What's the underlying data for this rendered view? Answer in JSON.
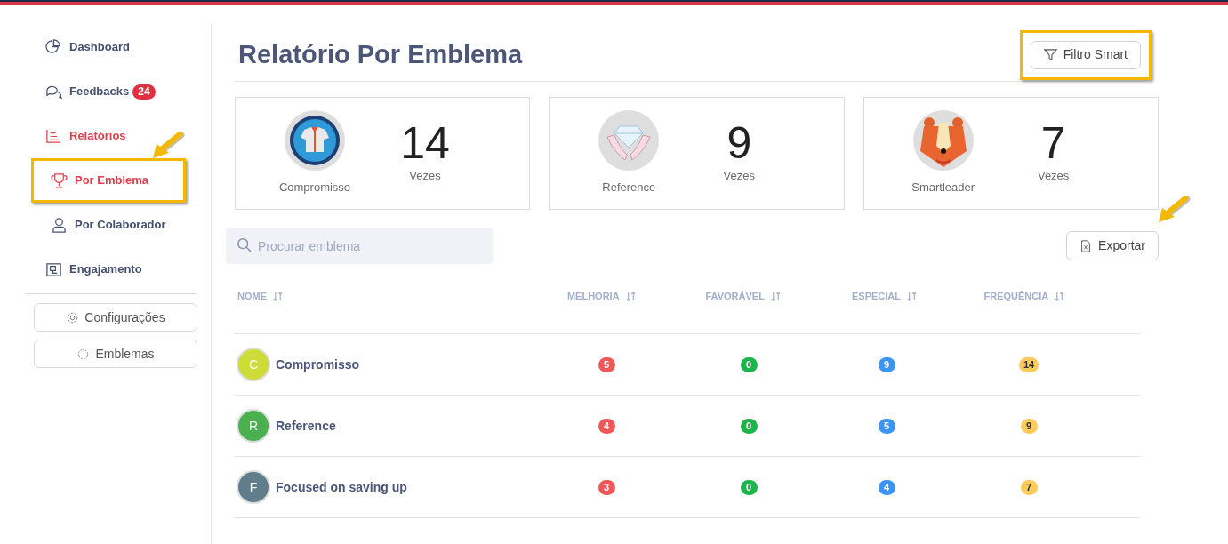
{
  "sidebar": {
    "items": [
      {
        "label": "Dashboard",
        "selected": false
      },
      {
        "label": "Feedbacks",
        "selected": false,
        "badge": "24"
      },
      {
        "label": "Relatórios",
        "selected": true,
        "children": [
          {
            "label": "Por Emblema",
            "selected": true,
            "highlighted": true
          },
          {
            "label": "Por Colaborador",
            "selected": false,
            "highlighted": false
          }
        ]
      },
      {
        "label": "Engajamento",
        "selected": false
      }
    ],
    "buttons": [
      {
        "label": "Configurações"
      },
      {
        "label": "Emblemas"
      }
    ]
  },
  "page": {
    "title": "Relatório Por Emblema",
    "filter_button": {
      "label": "Filtro Smart",
      "highlighted": true
    }
  },
  "cards": [
    {
      "name": "Compromisso",
      "count": "14",
      "unit": "Vezes"
    },
    {
      "name": "Reference",
      "count": "9",
      "unit": "Vezes"
    },
    {
      "name": "Smartleader",
      "count": "7",
      "unit": "Vezes"
    }
  ],
  "search": {
    "placeholder": "Procurar emblema"
  },
  "export_button": {
    "label": "Exportar",
    "highlighted": true
  },
  "table": {
    "columns": [
      "NOME",
      "MELHORIA",
      "FAVORÁVEL",
      "ESPECIAL",
      "FREQUÊNCIA"
    ],
    "rows": [
      {
        "initial": "C",
        "color": "#cddc39",
        "name": "Compromisso",
        "values": [
          "5",
          "0",
          "9",
          "14"
        ]
      },
      {
        "initial": "R",
        "color": "#4caf50",
        "name": "Reference",
        "values": [
          "4",
          "0",
          "5",
          "9"
        ]
      },
      {
        "initial": "F",
        "color": "#607d8b",
        "name": "Focused on saving up",
        "values": [
          "3",
          "0",
          "4",
          "7"
        ]
      }
    ]
  }
}
